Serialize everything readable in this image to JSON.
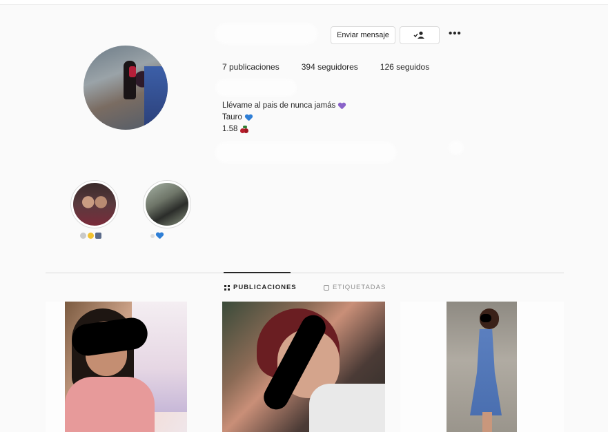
{
  "profile": {
    "username": "",
    "send_message_label": "Enviar mensaje",
    "follow_icon": "person-check-icon",
    "more_label": "•••"
  },
  "stats": {
    "posts": "7 publicaciones",
    "followers": "394 seguidores",
    "following": "126 seguidos"
  },
  "bio": {
    "line1": "Llévame al pais de nunca jamás",
    "line2": "Tauro",
    "line3": "1.58"
  },
  "highlights": [
    {
      "label": "",
      "icon": "highlight-1"
    },
    {
      "label": "",
      "icon": "highlight-2"
    }
  ],
  "tabs": [
    {
      "label": "PUBLICACIONES",
      "active": true
    },
    {
      "label": "ETIQUETADAS",
      "active": false
    }
  ],
  "colors": {
    "accent_purple": "#8a63c9",
    "accent_blue": "#2f7fd6"
  }
}
